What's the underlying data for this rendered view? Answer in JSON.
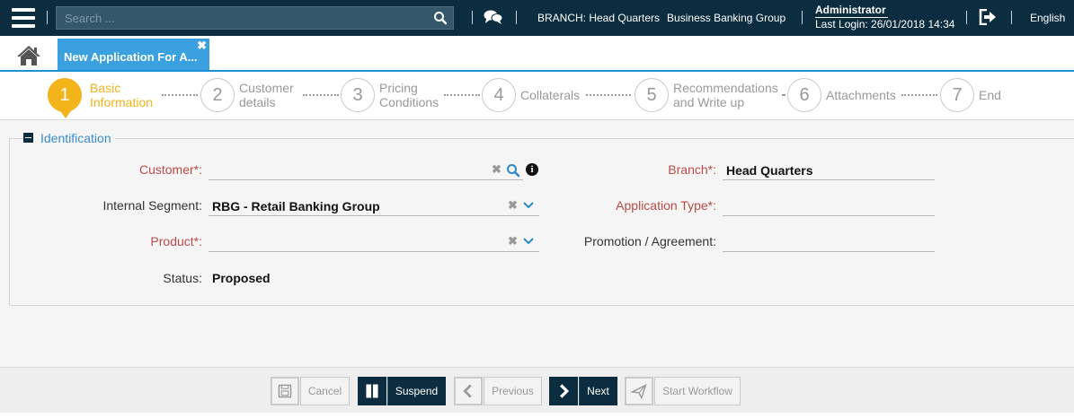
{
  "topbar": {
    "search_placeholder": "Search ...",
    "branch_label": "BRANCH: Head Quarters",
    "group_label": "Business Banking Group",
    "user_name": "Administrator",
    "last_login": "Last Login: 26/01/2018 14:34",
    "language": "English",
    "icons": [
      "menu-icon",
      "search-icon",
      "chat-icon",
      "logout-icon"
    ]
  },
  "tabs": {
    "home_icon": "home-icon",
    "active_tab_label": "New Application For A...",
    "close_glyph": "✖"
  },
  "stepper": {
    "steps": [
      {
        "number": "1",
        "line1": "Basic",
        "line2": "Information",
        "active": true
      },
      {
        "number": "2",
        "line1": "Customer",
        "line2": "details",
        "active": false
      },
      {
        "number": "3",
        "line1": "Pricing",
        "line2": "Conditions",
        "active": false
      },
      {
        "number": "4",
        "line1": "Collaterals",
        "line2": "",
        "active": false
      },
      {
        "number": "5",
        "line1": "Recommendations",
        "line2": "and Write up",
        "active": false
      },
      {
        "number": "6",
        "line1": "Attachments",
        "line2": "",
        "active": false
      },
      {
        "number": "7",
        "line1": "End",
        "line2": "",
        "active": false
      }
    ]
  },
  "identification": {
    "title": "Identification",
    "fields": {
      "customer_label": "Customer*:",
      "customer_value": "",
      "internal_segment_label": "Internal Segment:",
      "internal_segment_value": "RBG - Retail Banking Group",
      "product_label": "Product*:",
      "product_value": "",
      "status_label": "Status:",
      "status_value": "Proposed",
      "branch_label": "Branch*:",
      "branch_value": "Head Quarters",
      "application_type_label": "Application Type*:",
      "application_type_value": "",
      "promotion_label": "Promotion / Agreement:",
      "promotion_value": ""
    },
    "clear_glyph": "✖",
    "info_glyph": "i"
  },
  "footer": {
    "cancel_label": "Cancel",
    "suspend_label": "Suspend",
    "previous_label": "Previous",
    "next_label": "Next",
    "start_workflow_label": "Start Workflow"
  },
  "colors": {
    "topbar_bg": "#0b2d3f",
    "tab_active_bg": "#3aa0e0",
    "step_active": "#f2b31b",
    "required_label": "#b94a48",
    "legend_text": "#3a8ccc"
  }
}
